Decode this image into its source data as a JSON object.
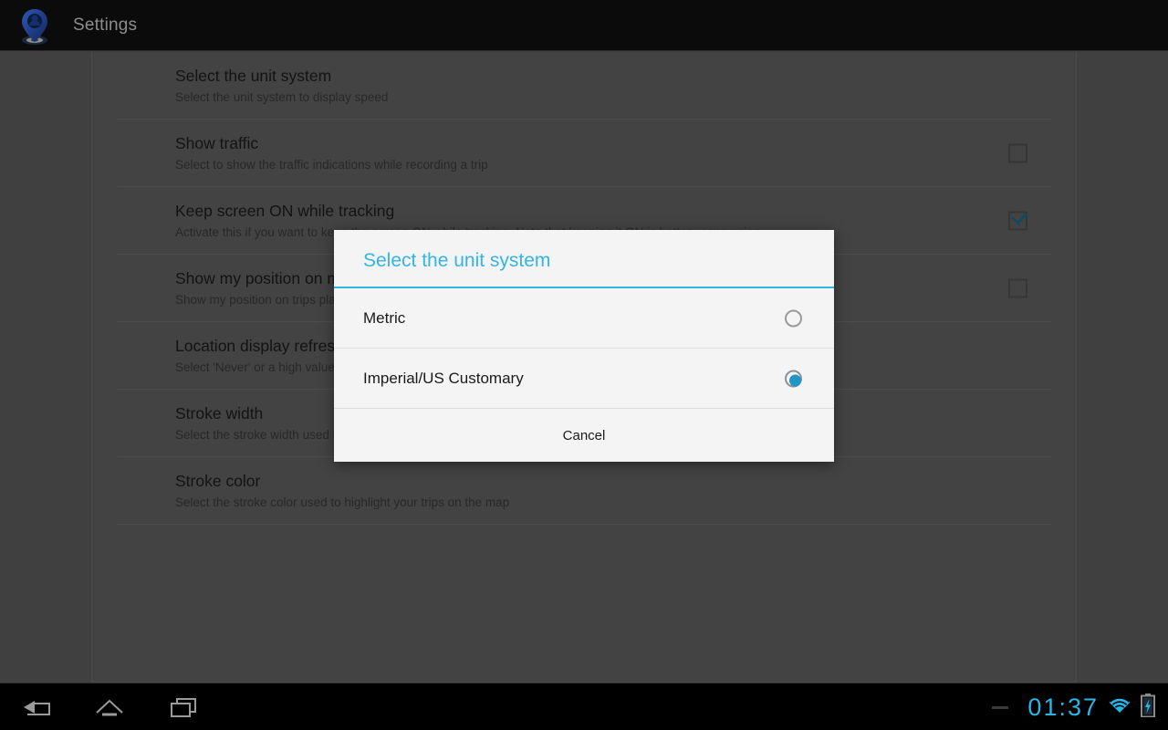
{
  "titlebar": {
    "app_icon": "location-pin-icon",
    "title": "Settings"
  },
  "preferences": [
    {
      "title": "Select the unit system",
      "summary": "Select the unit system to display speed",
      "widget": "none"
    },
    {
      "title": "Show traffic",
      "summary": "Select to show the traffic indications while recording a trip",
      "widget": "checkbox",
      "checked": false
    },
    {
      "title": "Keep screen ON while tracking",
      "summary": "Activate this if you want to keep the screen ON while tracking. Note that keeping it ON is battery consuming.",
      "widget": "checkbox",
      "checked": true
    },
    {
      "title": "Show my position on map",
      "summary": "Show my position on trips played on the map",
      "widget": "checkbox",
      "checked": false
    },
    {
      "title": "Location display refresh period",
      "summary": "Select 'Never' or a high value to save battery (a low value requires more battery power)",
      "widget": "none"
    },
    {
      "title": "Stroke width",
      "summary": "Select the stroke width used to highlight your trips on the map",
      "widget": "none"
    },
    {
      "title": "Stroke color",
      "summary": "Select the stroke color used to highlight your trips on the map",
      "widget": "none"
    }
  ],
  "dialog": {
    "title": "Select the unit system",
    "accent_color": "#33b5e5",
    "options": [
      {
        "label": "Metric",
        "selected": false
      },
      {
        "label": "Imperial/US Customary",
        "selected": true
      }
    ],
    "cancel_label": "Cancel"
  },
  "navbar": {
    "back_icon": "back-arrow-icon",
    "home_icon": "home-icon",
    "recent_icon": "recent-apps-icon",
    "clock": "01:37",
    "wifi_icon": "wifi-icon",
    "battery_icon": "battery-charging-icon",
    "clock_color": "#29b6e8"
  }
}
